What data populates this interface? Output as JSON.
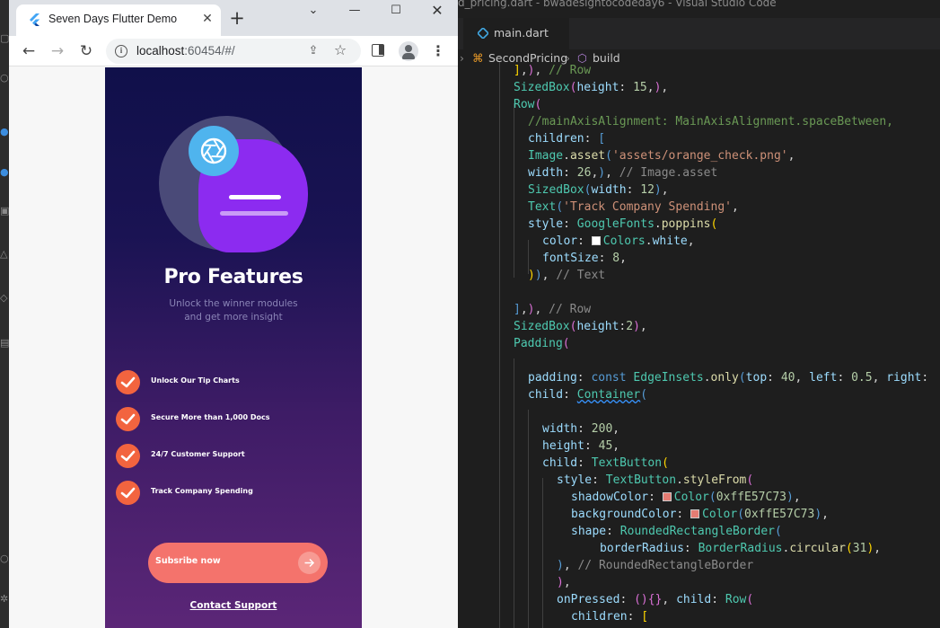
{
  "browser": {
    "tab_title": "Seven Days Flutter Demo",
    "url_host": "localhost",
    "url_rest": ":60454/#/"
  },
  "app": {
    "title": "Pro Features",
    "subtitle_line1": "Unlock the winner modules",
    "subtitle_line2": "and get more insight",
    "features": [
      "Unlock Our Tip Charts",
      "Secure More than 1,000 Docs",
      "24/7 Customer Support",
      "Track Company Spending"
    ],
    "subscribe_label": "Subsribe now",
    "contact_label": "Contact Support",
    "colors": {
      "check": "#f2643f",
      "button": "#f4736c",
      "blob": "#8c2bf0",
      "badge": "#4fb4ee"
    }
  },
  "editor": {
    "window_title": "d_pricing.dart - bwadesigntocodeday6 - Visual Studio Code",
    "tab_label": "main.dart",
    "breadcrumb_class": "SecondPricing",
    "breadcrumb_method": "build",
    "code_lines": [
      "],), // Row",
      "SizedBox(height: 15,),",
      "Row(",
      "//mainAxisAlignment: MainAxisAlignment.spaceBetween,",
      "children: [",
      "Image.asset('assets/orange_check.png',",
      "width: 26,), // Image.asset",
      "SizedBox(width: 12),",
      "Text('Track Company Spending',",
      "style: GoogleFonts.poppins(",
      "color: Colors.white,",
      "fontSize: 8,",
      ")), // Text",
      "",
      "],), // Row",
      "SizedBox(height:2),",
      "Padding(",
      "",
      "padding: const EdgeInsets.only(top: 40, left: 0.5, right:",
      "child: Container(",
      "",
      "width: 200,",
      "height: 45,",
      "child: TextButton(",
      "style: TextButton.styleFrom(",
      "shadowColor: Color(0xffE57C73),",
      "backgroundColor: Color(0xffE57C73),",
      "shape: RoundedRectangleBorder(",
      "borderRadius: BorderRadius.circular(31),",
      "), // RoundedRectangleBorder",
      "),",
      "onPressed: (){}, child: Row(",
      "children: ["
    ]
  }
}
